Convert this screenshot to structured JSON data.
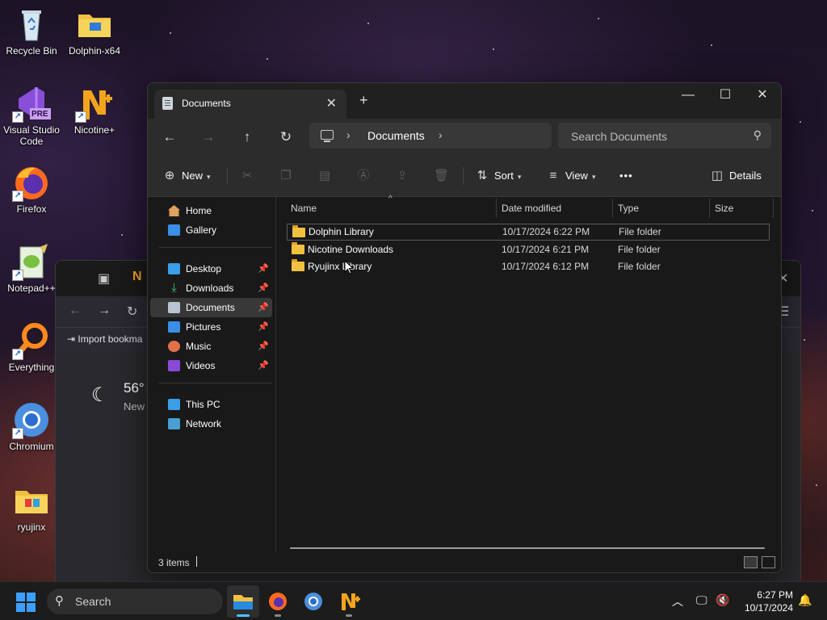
{
  "desktop": {
    "icons": [
      {
        "label": "Recycle Bin"
      },
      {
        "label": "Dolphin-x64"
      },
      {
        "label": "Visual Studio Code",
        "badge": "PRE"
      },
      {
        "label": "Nicotine+"
      },
      {
        "label": "Firefox"
      },
      {
        "label": "Notepad++"
      },
      {
        "label": "Everything"
      },
      {
        "label": "Chromium"
      },
      {
        "label": "ryujinx"
      }
    ]
  },
  "background_window": {
    "bookmark_label": "Import bookma",
    "weather_temp": "56°",
    "weather_sub": "New"
  },
  "explorer": {
    "tab_title": "Documents",
    "address": {
      "crumb": "Documents"
    },
    "search": {
      "placeholder": "Search Documents"
    },
    "commands": {
      "new_label": "New",
      "sort_label": "Sort",
      "view_label": "View",
      "more_label": "•••",
      "details_label": "Details"
    },
    "nav": {
      "home": "Home",
      "gallery": "Gallery",
      "desktop": "Desktop",
      "downloads": "Downloads",
      "documents": "Documents",
      "pictures": "Pictures",
      "music": "Music",
      "videos": "Videos",
      "this_pc": "This PC",
      "network": "Network"
    },
    "columns": {
      "name": "Name",
      "date": "Date modified",
      "type": "Type",
      "size": "Size"
    },
    "rows": [
      {
        "name": "Dolphin Library",
        "date": "10/17/2024 6:22 PM",
        "type": "File folder"
      },
      {
        "name": "Nicotine Downloads",
        "date": "10/17/2024 6:21 PM",
        "type": "File folder"
      },
      {
        "name": "Ryujinx Library",
        "date": "10/17/2024 6:12 PM",
        "type": "File folder"
      }
    ],
    "status": {
      "count": "3 items"
    }
  },
  "taskbar": {
    "search_label": "Search",
    "time": "6:27 PM",
    "date": "10/17/2024"
  },
  "colors": {
    "accent": "#4cc2ff",
    "folder": "#f0c040"
  }
}
